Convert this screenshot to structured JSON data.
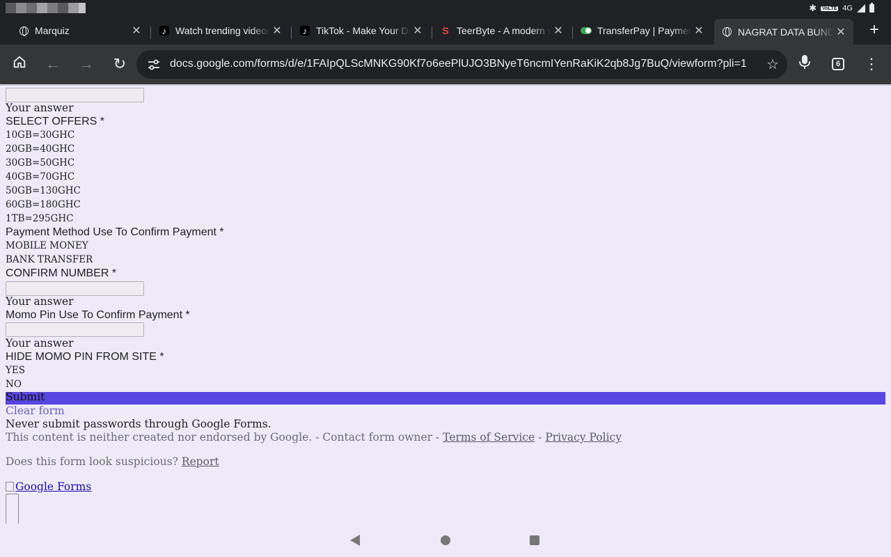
{
  "status_bar": {
    "network": "4G",
    "volte": "VoLTE",
    "bluetooth_icon": "bluetooth-icon",
    "signal_icon": "signal-icon",
    "battery_icon": "battery-icon"
  },
  "tabs": [
    {
      "title": "Marquiz",
      "icon": "globe-icon",
      "active": false
    },
    {
      "title": "Watch trending videos for you | TikTok",
      "icon": "tiktok-icon",
      "active": false
    },
    {
      "title": "TikTok - Make Your Day",
      "icon": "tiktok-icon",
      "active": false
    },
    {
      "title": "TeerByte - A modern system",
      "icon": "teerbyte-icon",
      "active": false
    },
    {
      "title": "TransferPay | Payments",
      "icon": "toggle-icon",
      "active": false
    },
    {
      "title": "NAGRAT DATA BUNDLE",
      "icon": "globe-icon",
      "active": true
    }
  ],
  "new_tab": "+",
  "toolbar": {
    "url": "docs.google.com/forms/d/e/1FAIpQLScMNKG90Kf7o6eePlUJO3BNyeT6ncmIYenRaKiK2qb8Jg7BuQ/viewform?pli=1",
    "tab_count": "6"
  },
  "form": {
    "answer_placeholder": "Your answer",
    "select_offers_label": "SELECT OFFERS *",
    "offers": [
      "10GB=30GHC",
      "20GB=40GHC",
      "30GB=50GHC",
      "40GB=70GHC",
      "50GB=130GHC",
      "60GB=180GHC",
      "1TB=295GHC"
    ],
    "payment_method_label": "Payment Method Use To Confirm Payment *",
    "payment_methods": [
      "MOBILE MONEY",
      "BANK TRANSFER"
    ],
    "confirm_number_label": "CONFIRM NUMBER *",
    "momo_pin_label": "Momo Pin Use To Confirm Payment *",
    "hide_pin_label": "HIDE MOMO PIN FROM SITE *",
    "hide_pin_options": [
      "YES",
      "NO"
    ],
    "submit_label": "Submit",
    "clear_label": "Clear form",
    "warning": "Never submit passwords through Google Forms.",
    "disclaimer_prefix": "This content is neither created nor endorsed by Google. - Contact form owner -",
    "terms_link": "Terms of Service",
    "separator": "-",
    "privacy_link": "Privacy Policy",
    "suspicious_text": "Does this form look suspicious?",
    "report_link": "Report",
    "google_forms_link": "Google Forms"
  },
  "colors": {
    "submit_bar": "#5846e0",
    "page_bg": "#eeeaf8",
    "chrome_dark": "#202124"
  }
}
